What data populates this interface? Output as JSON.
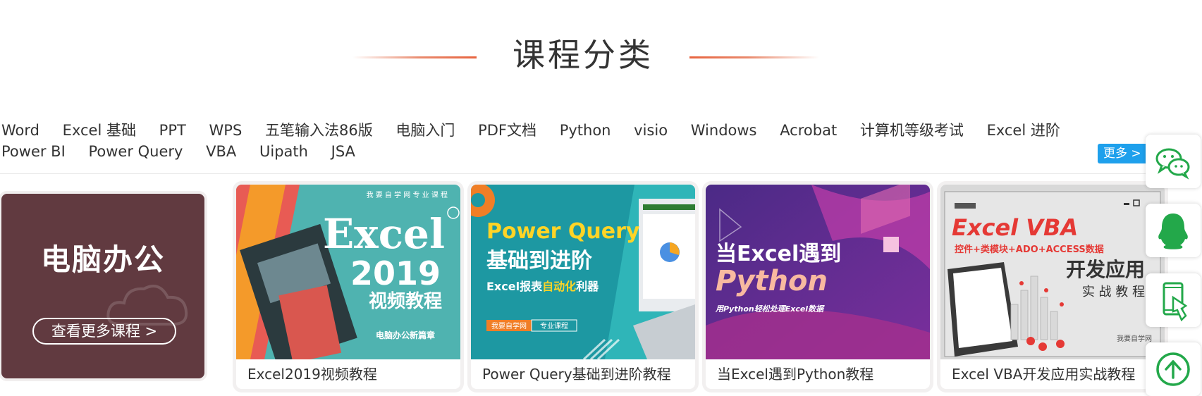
{
  "section": {
    "title": "课程分类"
  },
  "tags": {
    "row1": [
      "Word",
      "Excel 基础",
      "PPT",
      "WPS",
      "五笔输入法86版",
      "电脑入门",
      "PDF文档",
      "Python",
      "visio",
      "Windows",
      "Acrobat",
      "计算机等级考试",
      "Excel 进阶"
    ],
    "row2": [
      "Power BI",
      "Power Query",
      "VBA",
      "Uipath",
      "JSA"
    ],
    "more_label": "更多 >"
  },
  "promo": {
    "title": "电脑办公",
    "button_label": "查看更多课程 >"
  },
  "cards": [
    {
      "caption": "Excel2019视频教程",
      "thumb": {
        "top_text": "我 要 自 学 网 专 业 课 程",
        "big1": "Excel",
        "big2": "2019",
        "sub": "视频教程",
        "footer": "电脑办公新篇章"
      }
    },
    {
      "caption": "Power Query基础到进阶教程",
      "thumb": {
        "big1": "Power Query",
        "big2": "基础到进阶",
        "sub_a": "Excel报表",
        "sub_b": "自动化",
        "sub_c": "利器",
        "tag_a": "我要自学网",
        "tag_b": "专业课程"
      }
    },
    {
      "caption": "当Excel遇到Python教程",
      "thumb": {
        "big1": "当Excel遇到",
        "big2": "Python",
        "sub": "用Python轻松处理Excel数据"
      }
    },
    {
      "caption": "Excel VBA开发应用实战教程",
      "thumb": {
        "big1": "Excel VBA",
        "sub": "控件+类模块+ADO+ACCESS数据",
        "big2": "开发应用",
        "sub2": "实 战 教 程",
        "corner": "我要自学网"
      }
    }
  ],
  "side": {
    "icons": [
      "wechat-icon",
      "qq-icon",
      "mobile-icon",
      "back-to-top-icon"
    ]
  },
  "colors": {
    "accent_blue": "#1ea0ec",
    "side_green": "#23a84a",
    "title_line": "#e8643f"
  }
}
